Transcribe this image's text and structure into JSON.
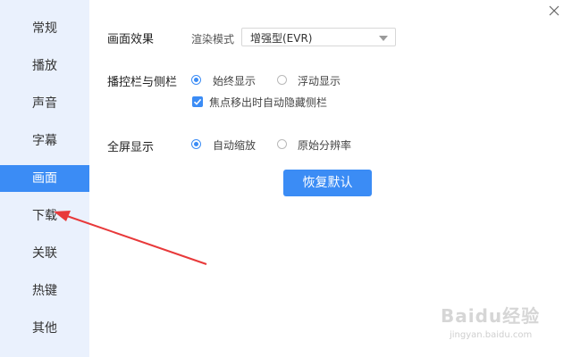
{
  "sidebar": {
    "items": [
      {
        "label": "常规"
      },
      {
        "label": "播放"
      },
      {
        "label": "声音"
      },
      {
        "label": "字幕"
      },
      {
        "label": "画面"
      },
      {
        "label": "下载"
      },
      {
        "label": "关联"
      },
      {
        "label": "热键"
      },
      {
        "label": "其他"
      }
    ],
    "active_item": "画面"
  },
  "picture_effect": {
    "label": "画面效果",
    "render_mode_label": "渲染模式",
    "render_mode_value": "增强型(EVR)"
  },
  "control_bar": {
    "label": "播控栏与侧栏",
    "option_always": "始终显示",
    "option_float": "浮动显示",
    "selected": "始终显示",
    "autohide_label": "焦点移出时自动隐藏侧栏",
    "autohide_checked": true
  },
  "fullscreen": {
    "label": "全屏显示",
    "option_autoscale": "自动缩放",
    "option_original": "原始分辨率",
    "selected": "自动缩放"
  },
  "restore_button": {
    "label": "恢复默认"
  },
  "watermark": {
    "main": "Baidu经验",
    "sub": "jingyan.baidu.com"
  },
  "colors": {
    "accent": "#3b8cf5",
    "sidebar_bg": "#eaf1fd",
    "annotation": "#e8393a"
  }
}
